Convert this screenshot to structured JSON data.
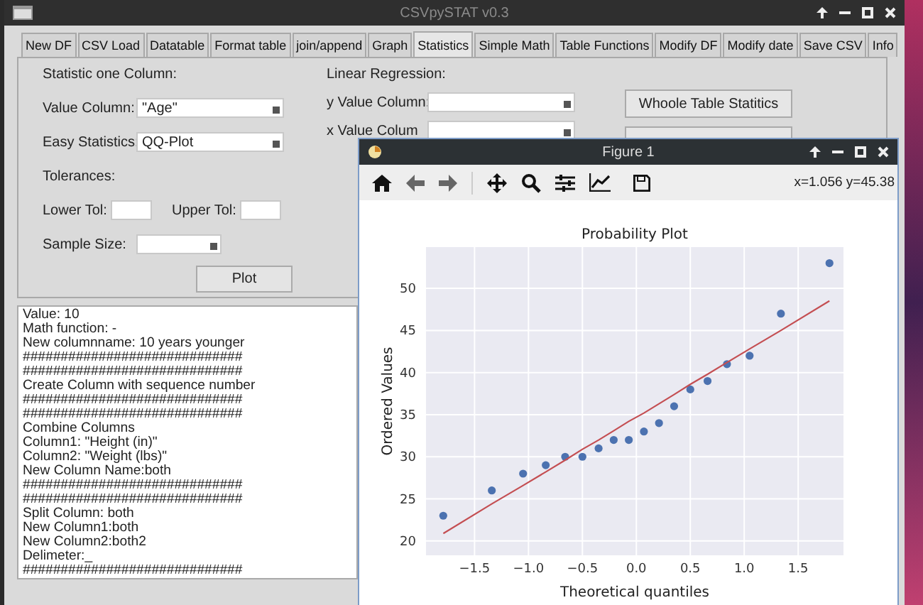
{
  "window": {
    "title": "CSVpySTAT v0.3"
  },
  "tabs": [
    {
      "label": "New DF",
      "selected": false
    },
    {
      "label": "CSV Load",
      "selected": false
    },
    {
      "label": "Datatable",
      "selected": false
    },
    {
      "label": "Format table",
      "selected": false
    },
    {
      "label": "join/append",
      "selected": false
    },
    {
      "label": "Graph",
      "selected": false
    },
    {
      "label": "Statistics",
      "selected": true
    },
    {
      "label": "Simple Math",
      "selected": false
    },
    {
      "label": "Table Functions",
      "selected": false
    },
    {
      "label": "Modify DF",
      "selected": false
    },
    {
      "label": "Modify date",
      "selected": false
    },
    {
      "label": "Save CSV",
      "selected": false
    },
    {
      "label": "Info",
      "selected": false
    }
  ],
  "statistic_one_column": {
    "heading": "Statistic one Column:",
    "value_column": {
      "label": "Value Column:",
      "value": "\"Age\""
    },
    "easy_statistics": {
      "label": "Easy Statistics:",
      "value": "QQ-Plot"
    },
    "tolerances_heading": "Tolerances:",
    "lower_tol": {
      "label": "Lower Tol:"
    },
    "upper_tol": {
      "label": "Upper Tol:"
    },
    "sample_size": {
      "label": "Sample Size:"
    },
    "plot_button": "Plot"
  },
  "linear_regression": {
    "heading": "Linear Regression:",
    "y_value_column": {
      "label": "y Value Column:"
    },
    "x_value_column": {
      "label": "x Value Colum"
    }
  },
  "buttons": [
    "Whoole Table Statitics"
  ],
  "log_lines": [
    "Value: 10",
    "Math function: -",
    "New columnname: 10 years younger",
    "#############################",
    "#############################",
    "Create Column with sequence number",
    "#############################",
    "#############################",
    "Combine Columns",
    "Column1: \"Height (in)\"",
    "Column2: \"Weight (lbs)\"",
    "New Column Name:both",
    "#############################",
    "#############################",
    "Split Column: both",
    "New Column1:both",
    "New Column2:both2",
    "Delimeter:_",
    "#############################"
  ],
  "figure_window": {
    "title": "Figure 1",
    "coordinates": "x=1.056 y=45.38",
    "chart_data": {
      "type": "scatter",
      "title": "Probability Plot",
      "xlabel": "Theoretical quantiles",
      "ylabel": "Ordered Values",
      "x": [
        -1.79,
        -1.34,
        -1.05,
        -0.84,
        -0.66,
        -0.5,
        -0.35,
        -0.21,
        -0.07,
        0.07,
        0.21,
        0.35,
        0.5,
        0.66,
        0.84,
        1.05,
        1.34,
        1.79
      ],
      "series": [
        {
          "type": "scatter",
          "color": "#4c72b0",
          "values": [
            23,
            26,
            28,
            29,
            30,
            30,
            31,
            32,
            32,
            33,
            34,
            36,
            38,
            39,
            41,
            42,
            47,
            53
          ]
        },
        {
          "type": "line",
          "color": "#c44e52",
          "values": [
            20.9,
            24.4,
            26.6,
            28.2,
            29.6,
            30.9,
            32.0,
            33.1,
            34.2,
            35.2,
            36.3,
            37.4,
            38.6,
            39.8,
            41.2,
            42.8,
            45.0,
            48.5
          ]
        }
      ],
      "grid": true,
      "xlim": [
        -1.95,
        1.92
      ],
      "ylim": [
        18.3,
        54.9
      ],
      "xticks": [
        {
          "value": -1.5,
          "label": "−1.5"
        },
        {
          "value": -1.0,
          "label": "−1.0"
        },
        {
          "value": -0.5,
          "label": "−0.5"
        },
        {
          "value": 0,
          "label": "0.0"
        },
        {
          "value": 0.5,
          "label": "0.5"
        },
        {
          "value": 1.0,
          "label": "1.0"
        },
        {
          "value": 1.5,
          "label": "1.5"
        }
      ],
      "yticks": [
        20,
        25,
        30,
        35,
        40,
        45,
        50
      ]
    }
  }
}
